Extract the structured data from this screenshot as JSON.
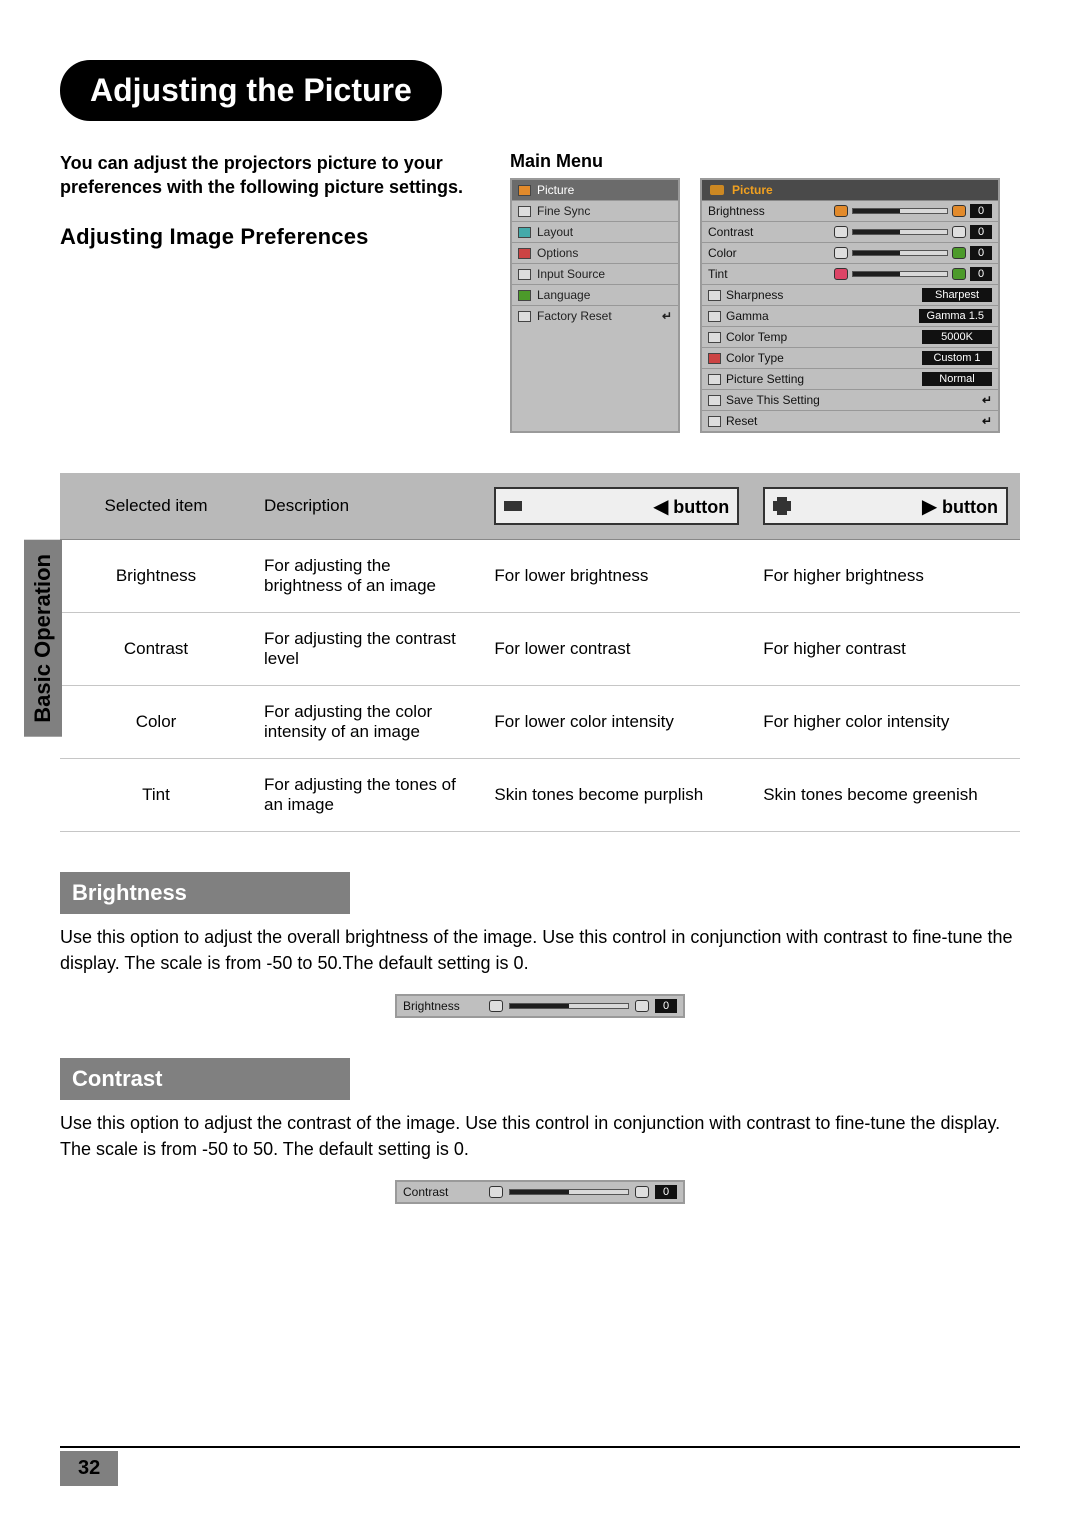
{
  "page": {
    "title": "Adjusting the Picture",
    "intro": "You can adjust the projectors picture to your preferences with the following picture settings.",
    "subtitle": "Adjusting Image Preferences",
    "side_tab": "Basic Operation",
    "page_number": "32"
  },
  "main_menu": {
    "label": "Main Menu",
    "items": [
      {
        "label": "Picture",
        "selected": true
      },
      {
        "label": "Fine Sync"
      },
      {
        "label": "Layout"
      },
      {
        "label": "Options"
      },
      {
        "label": "Input Source"
      },
      {
        "label": "Language"
      },
      {
        "label": "Factory Reset",
        "enter": true
      }
    ]
  },
  "picture_menu": {
    "header": "Picture",
    "sliders": [
      {
        "label": "Brightness",
        "value": "0",
        "knob": "orange"
      },
      {
        "label": "Contrast",
        "value": "0",
        "knob": ""
      },
      {
        "label": "Color",
        "value": "0",
        "knob": "green"
      },
      {
        "label": "Tint",
        "value": "0",
        "knob": "pink"
      }
    ],
    "selects": [
      {
        "label": "Sharpness",
        "value": "Sharpest"
      },
      {
        "label": "Gamma",
        "value": "Gamma 1.5"
      },
      {
        "label": "Color Temp",
        "value": "5000K"
      },
      {
        "label": "Color Type",
        "value": "Custom 1"
      },
      {
        "label": "Picture Setting",
        "value": "Normal"
      }
    ],
    "actions": [
      {
        "label": "Save This Setting"
      },
      {
        "label": "Reset"
      }
    ]
  },
  "pref_table": {
    "headers": {
      "item": "Selected item",
      "desc": "Description",
      "left": "button",
      "right": "button"
    },
    "rows": [
      {
        "item": "Brightness",
        "desc": "For adjusting the brightness of an image",
        "left": "For lower brightness",
        "right": "For higher brightness"
      },
      {
        "item": "Contrast",
        "desc": "For adjusting the contrast level",
        "left": "For lower contrast",
        "right": "For higher contrast"
      },
      {
        "item": "Color",
        "desc": "For adjusting the color intensity of an image",
        "left": "For lower color intensity",
        "right": "For higher color intensity"
      },
      {
        "item": "Tint",
        "desc": "For adjusting the tones of an image",
        "left": "Skin tones become purplish",
        "right": "Skin tones become greenish"
      }
    ]
  },
  "sections": {
    "brightness": {
      "heading": "Brightness",
      "text": "Use this option to adjust the overall brightness of the image. Use this control in conjunction with contrast to fine-tune the display. The scale is from -50 to 50.The default setting is 0.",
      "slider_label": "Brightness",
      "slider_value": "0"
    },
    "contrast": {
      "heading": "Contrast",
      "text": "Use this option to adjust the contrast of the image. Use this control in conjunction with contrast to fine-tune the display. The scale is from -50 to 50. The default setting is 0.",
      "slider_label": "Contrast",
      "slider_value": "0"
    }
  }
}
